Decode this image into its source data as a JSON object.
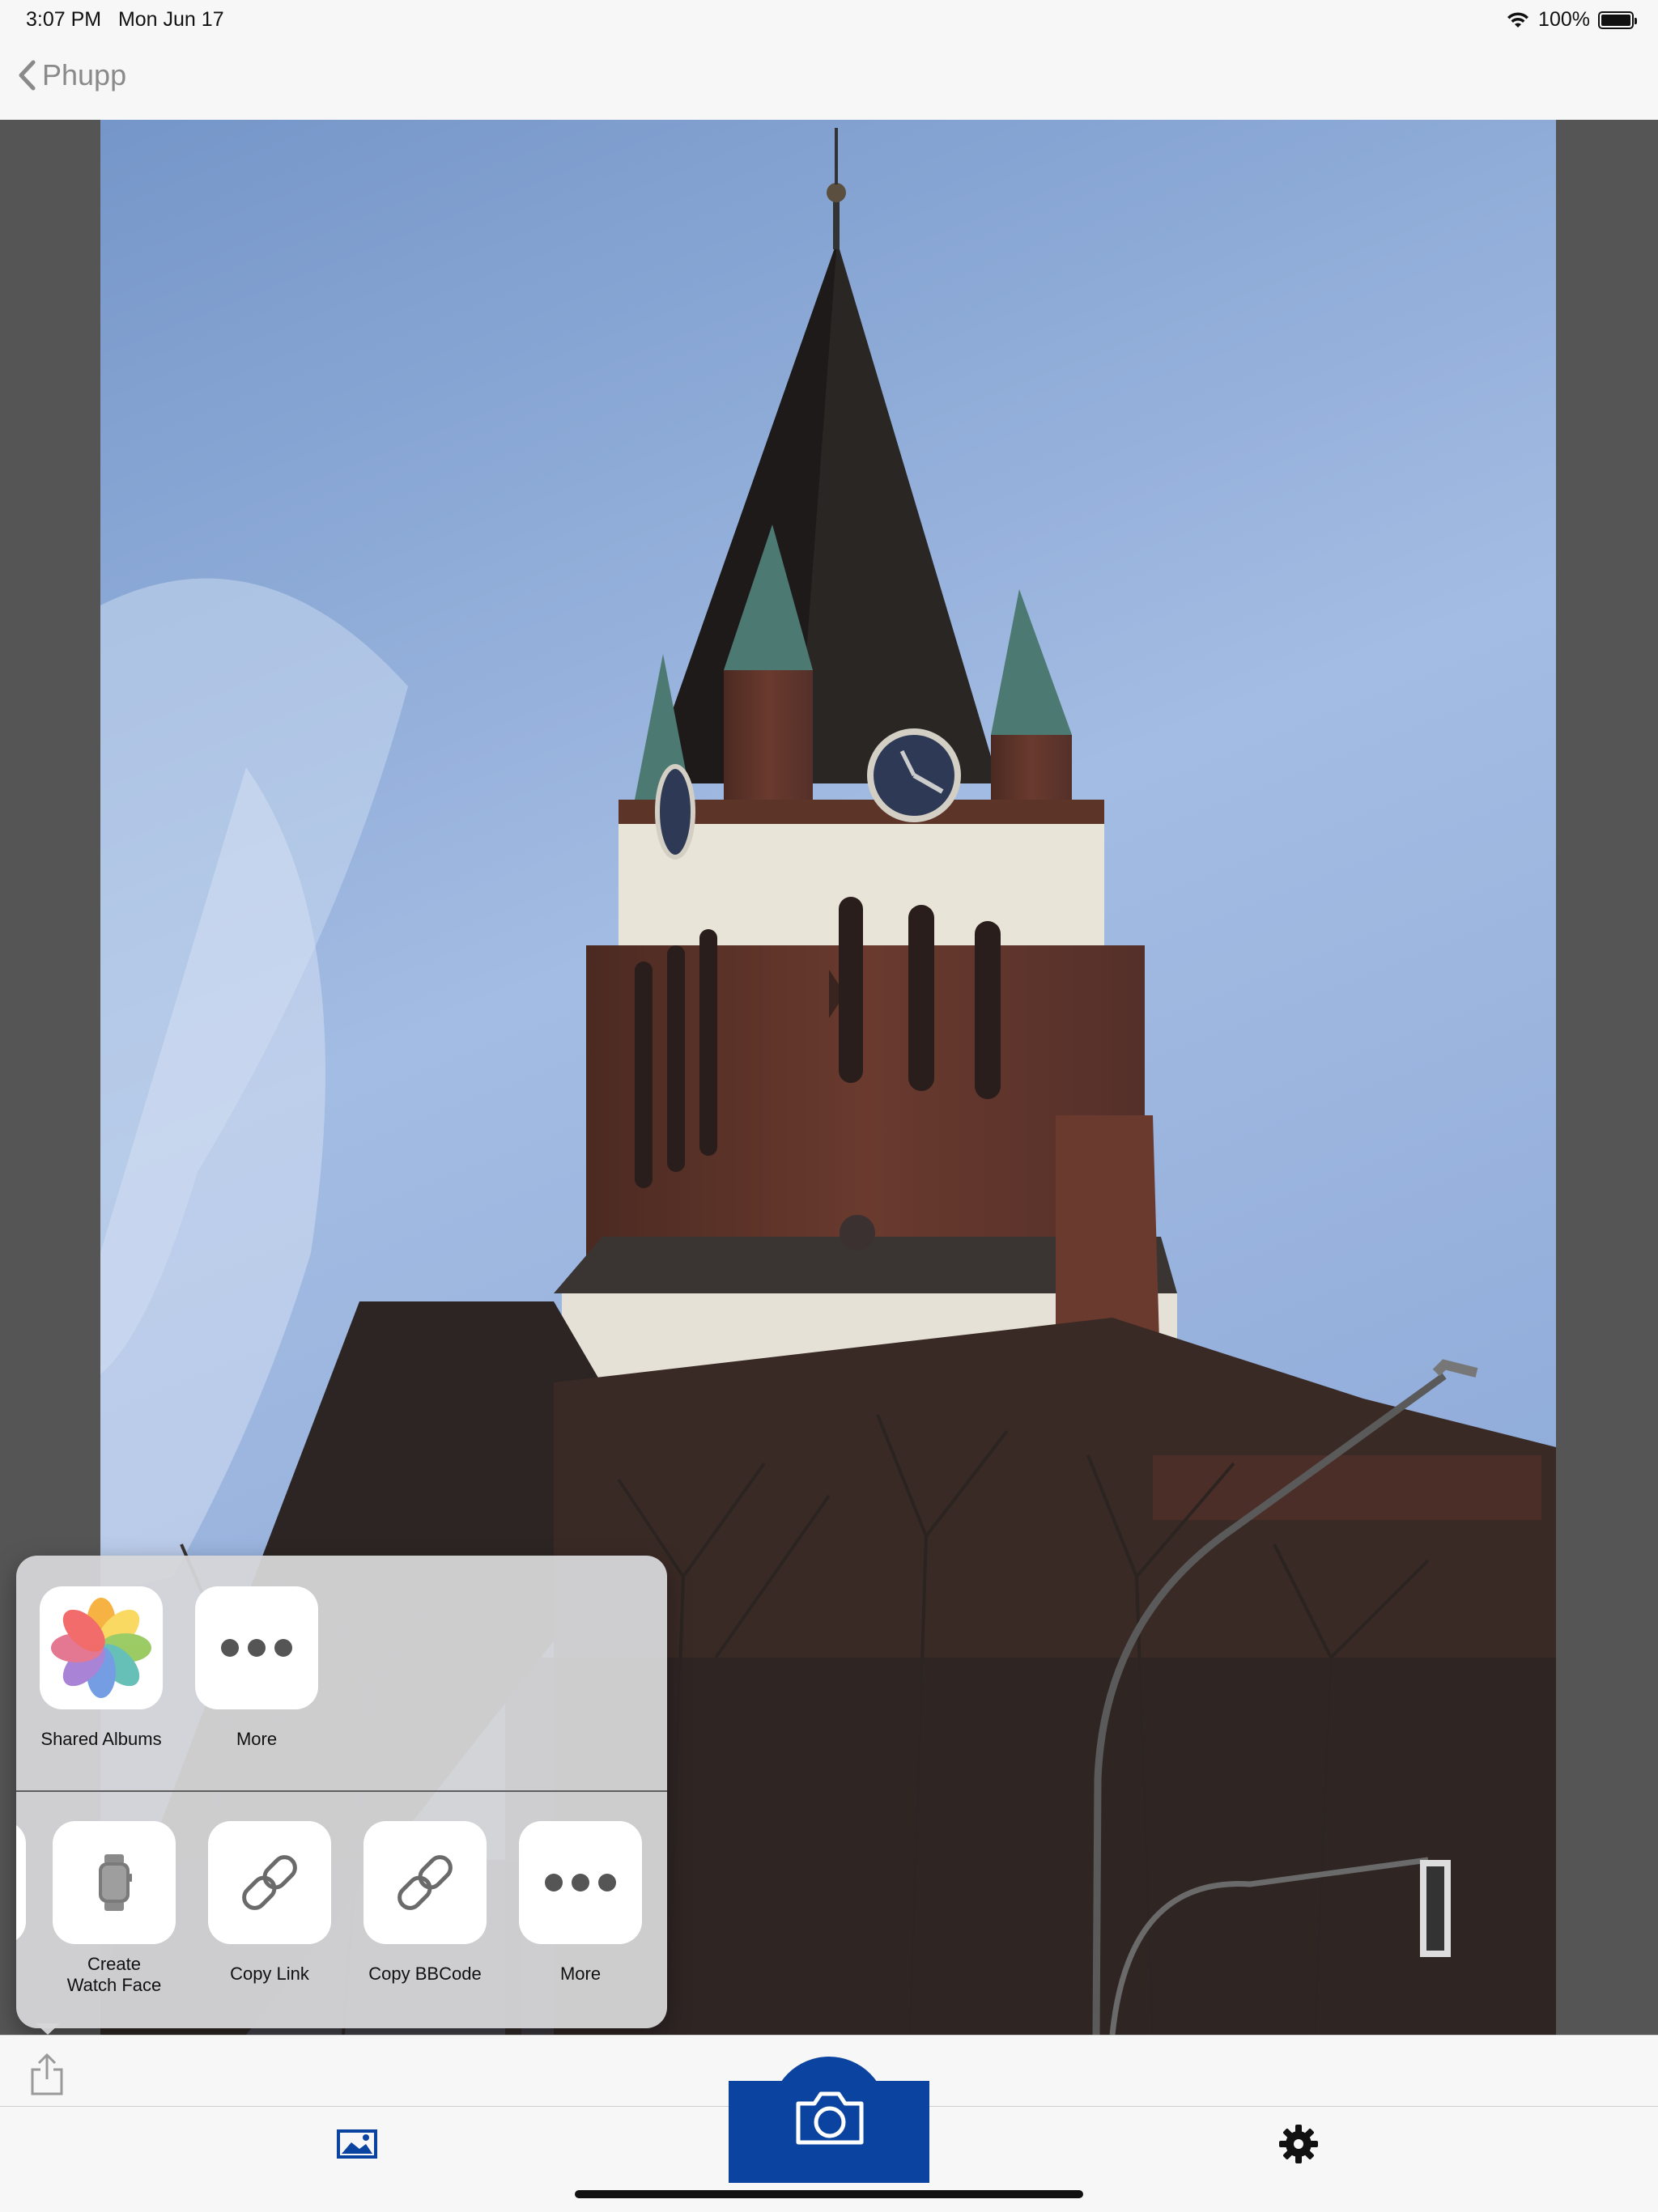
{
  "status_bar": {
    "time": "3:07 PM",
    "date": "Mon Jun 17",
    "battery": "100%",
    "wifi_icon": "wifi-icon",
    "battery_icon": "battery-icon"
  },
  "nav": {
    "back_label": "Phupp"
  },
  "photo": {
    "subject": "church-tower-photo"
  },
  "share_sheet": {
    "top_row": [
      {
        "label": "Shared Albums",
        "icon": "photos-app-icon"
      },
      {
        "label": "More",
        "icon": "more-icon"
      }
    ],
    "bottom_row": [
      {
        "label": "Create Watch Face",
        "icon": "watch-icon"
      },
      {
        "label": "Copy Link",
        "icon": "link-icon"
      },
      {
        "label": "Copy BBCode",
        "icon": "link-icon"
      },
      {
        "label": "More",
        "icon": "more-icon"
      }
    ]
  },
  "toolbar": {
    "share_icon": "share-icon"
  },
  "tab_bar": {
    "photos_icon": "photos-tab-icon",
    "camera_icon": "camera-icon",
    "settings_icon": "gear-icon"
  },
  "colors": {
    "accent": "#0b44a0",
    "sky_top": "#7596c9",
    "sky_bottom": "#a7bfe6",
    "bar_background": "#f7f7f7"
  }
}
